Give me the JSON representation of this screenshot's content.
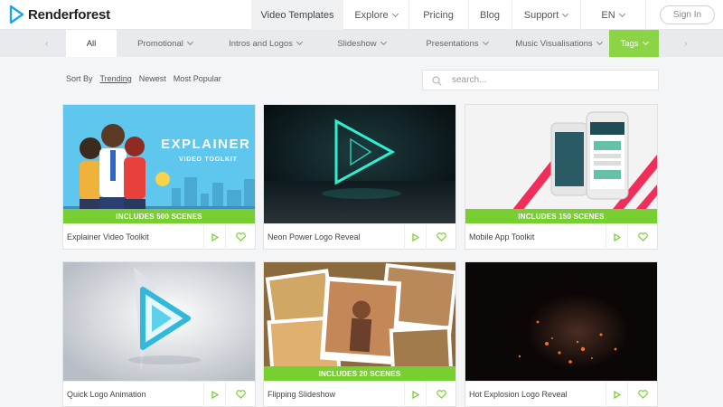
{
  "brand": {
    "name": "Renderforest",
    "accent": "#8bd445",
    "logo_color": "#1aa7e8"
  },
  "nav": {
    "items": [
      {
        "label": "Video Templates"
      },
      {
        "label": "Explore"
      },
      {
        "label": "Pricing"
      },
      {
        "label": "Blog"
      },
      {
        "label": "Support"
      },
      {
        "label": "EN"
      }
    ],
    "signin": "Sign In"
  },
  "categories": [
    {
      "label": "All"
    },
    {
      "label": "Promotional"
    },
    {
      "label": "Intros and Logos"
    },
    {
      "label": "Slideshow"
    },
    {
      "label": "Presentations"
    },
    {
      "label": "Music Visualisations"
    },
    {
      "label": "Tags"
    }
  ],
  "sort": {
    "label": "Sort By",
    "options": [
      "Trending",
      "Newest",
      "Most Popular"
    ],
    "active": "Trending"
  },
  "search": {
    "placeholder": "search..."
  },
  "cards": [
    {
      "title": "Explainer Video Toolkit",
      "badge": "INCLUDES 500 SCENES",
      "thumb_text": "EXPLAINER",
      "thumb_subtext": "VIDEO TOOLKIT"
    },
    {
      "title": "Neon Power Logo Reveal",
      "badge": ""
    },
    {
      "title": "Mobile App Toolkit",
      "badge": "INCLUDES 150 SCENES"
    },
    {
      "title": "Quick Logo Animation",
      "badge": ""
    },
    {
      "title": "Flipping Slideshow",
      "badge": "INCLUDES 20 SCENES"
    },
    {
      "title": "Hot Explosion Logo Reveal",
      "badge": ""
    }
  ],
  "icons": {
    "logo": "play-triangle-logo-icon",
    "search": "search-icon",
    "play": "play-icon",
    "like": "heart-icon",
    "caret": "chevron-down-icon"
  }
}
